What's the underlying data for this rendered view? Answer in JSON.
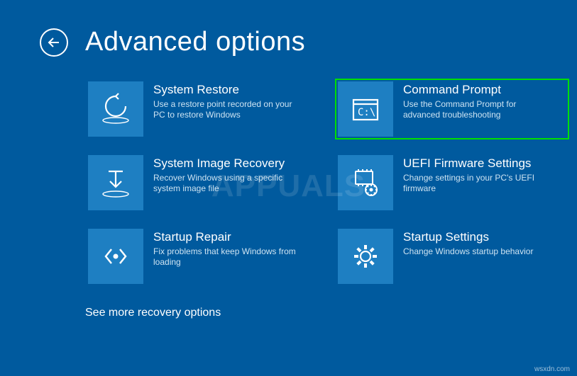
{
  "header": {
    "title": "Advanced options"
  },
  "tiles": {
    "system_restore": {
      "title": "System Restore",
      "desc": "Use a restore point recorded on your PC to restore Windows"
    },
    "command_prompt": {
      "title": "Command Prompt",
      "desc": "Use the Command Prompt for advanced troubleshooting"
    },
    "system_image": {
      "title": "System Image Recovery",
      "desc": "Recover Windows using a specific system image file"
    },
    "uefi": {
      "title": "UEFI Firmware Settings",
      "desc": "Change settings in your PC's UEFI firmware"
    },
    "startup_repair": {
      "title": "Startup Repair",
      "desc": "Fix problems that keep Windows from loading"
    },
    "startup_settings": {
      "title": "Startup Settings",
      "desc": "Change Windows startup behavior"
    }
  },
  "more_link": "See more recovery options",
  "watermark": "APPUALS",
  "source": "wsxdn.com"
}
